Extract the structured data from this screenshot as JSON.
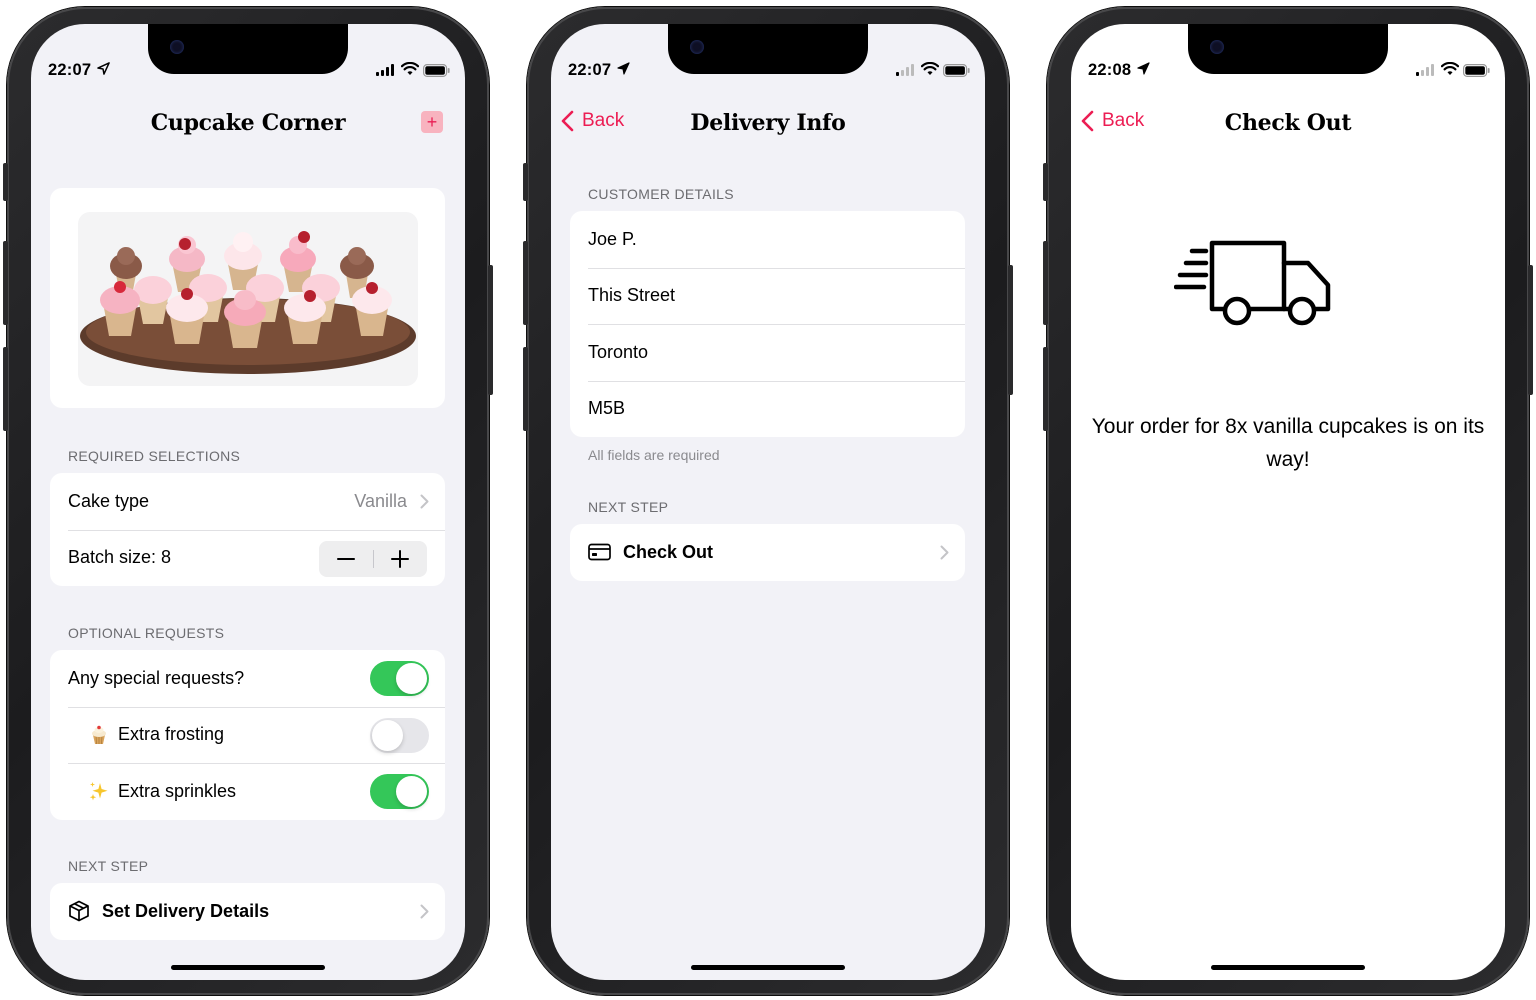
{
  "phones": [
    {
      "status": {
        "time": "22:07"
      },
      "title": "Cupcake Corner",
      "add_button_icon": "plus-icon",
      "sections": {
        "required_header": "REQUIRED SELECTIONS",
        "cake_type_label": "Cake type",
        "cake_type_value": "Vanilla",
        "batch_label": "Batch size: 8",
        "optional_header": "OPTIONAL REQUESTS",
        "special_label": "Any special requests?",
        "special_on": true,
        "frosting_emoji": "🧁",
        "frosting_label": "Extra frosting",
        "frosting_on": false,
        "sprinkles_emoji": "✨",
        "sprinkles_label": "Extra sprinkles",
        "sprinkles_on": true,
        "next_header": "NEXT STEP",
        "next_label": "Set Delivery Details"
      }
    },
    {
      "status": {
        "time": "22:07"
      },
      "back_label": "Back",
      "title": "Delivery Info",
      "customer_header": "CUSTOMER DETAILS",
      "fields": [
        "Joe P.",
        "This Street",
        "Toronto",
        "M5B"
      ],
      "footnote": "All fields are required",
      "next_header": "NEXT STEP",
      "next_label": "Check Out"
    },
    {
      "status": {
        "time": "22:08"
      },
      "back_label": "Back",
      "title": "Check Out",
      "message": "Your order for 8x vanilla cupcakes is on its way!"
    }
  ],
  "colors": {
    "accent": "#ec1d53",
    "toggle_on": "#34c759",
    "grouped_bg": "#f2f2f7"
  }
}
